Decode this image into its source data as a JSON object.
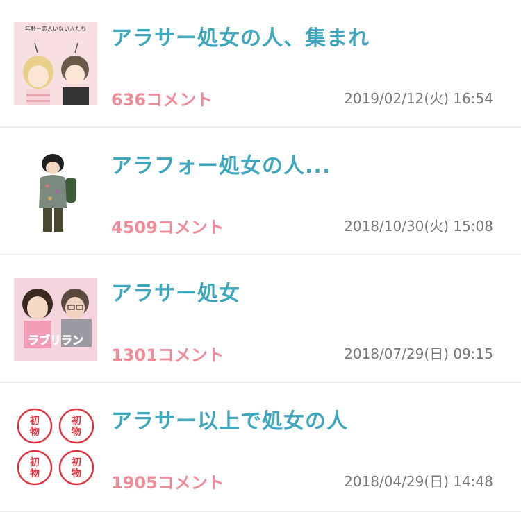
{
  "items": [
    {
      "title": "アラサー処女の人、集まれ",
      "comments": "636コメント",
      "date": "2019/02/12(火) 16:54",
      "thumb_icon": "two-people-illustration-icon",
      "thumb_text_top": "年齢＝恋人いない人たち"
    },
    {
      "title": "アラフォー処女の人...",
      "comments": "4509コメント",
      "date": "2018/10/30(火) 15:08",
      "thumb_icon": "person-with-backpack-icon"
    },
    {
      "title": "アラサー処女",
      "comments": "1301コメント",
      "date": "2018/07/29(日) 09:15",
      "thumb_icon": "drama-poster-icon",
      "thumb_logo": "ラブリラン"
    },
    {
      "title": "アラサー以上で処女の人",
      "comments": "1905コメント",
      "date": "2018/04/29(日) 14:48",
      "thumb_icon": "hatsumono-stamp-icon",
      "thumb_stamp": "初物"
    }
  ],
  "colors": {
    "title": "#3fa7bd",
    "comments": "#f08c9a",
    "date": "#777777",
    "divider": "#ececec",
    "stamp": "#e2343f"
  }
}
